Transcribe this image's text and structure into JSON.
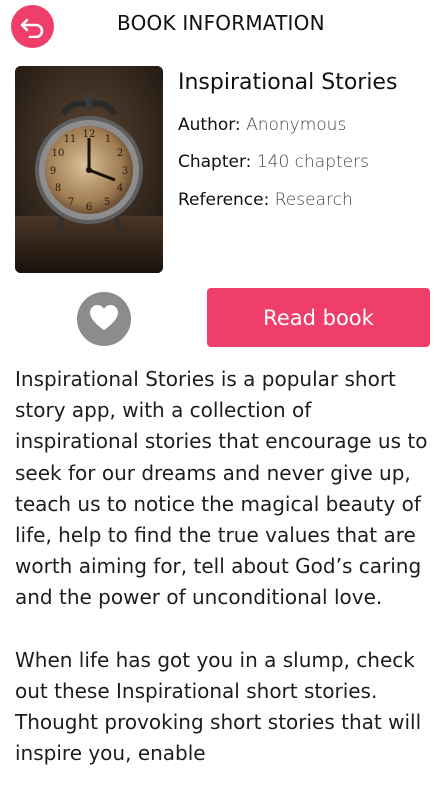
{
  "header": {
    "title": "BOOK INFORMATION",
    "back_icon": "back-arrow-icon",
    "accent_color": "#f03e6b"
  },
  "book": {
    "title": "Inspirational Stories",
    "author_label": "Author:",
    "author_value": "Anonymous",
    "chapter_label": "Chapter:",
    "chapter_value": "140 chapters",
    "reference_label": "Reference:",
    "reference_value": "Research"
  },
  "actions": {
    "favorite_icon": "heart-icon",
    "read_label": "Read book"
  },
  "description": {
    "paragraphs": [
      "Inspirational Stories is a popular short story app, with a collection of inspirational stories that encourage us to seek for our dreams and never give up, teach us to notice the magical beauty of life, help to find the true values that are worth aiming for, tell about God’s caring and the power of unconditional love.",
      "When life has got you in a slump, check out these Inspirational short stories. Thought provoking short stories that will inspire you, enable"
    ]
  }
}
